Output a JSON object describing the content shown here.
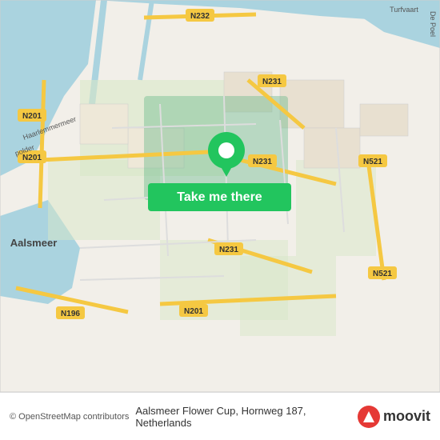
{
  "map": {
    "alt": "Map of Aalsmeer area, Netherlands",
    "pin_alt": "Location pin"
  },
  "button": {
    "label": "Take me there"
  },
  "bottom_bar": {
    "attribution": "© OpenStreetMap contributors",
    "location": "Aalsmeer Flower Cup, Hornweg 187, Netherlands"
  },
  "moovit": {
    "text": "moovit"
  },
  "road_labels": {
    "n232": "N232",
    "n231_top": "N231",
    "n231_mid1": "N231",
    "n231_mid2": "N231",
    "n201_left": "N201",
    "n201_left2": "N201",
    "n201_bot": "N201",
    "n196": "N196",
    "n231_bot": "N231",
    "n521": "N521",
    "n521_bot": "N521",
    "aalsmeer": "Aalsmeer"
  },
  "colors": {
    "button_bg": "#22c55e",
    "button_text": "#ffffff",
    "road_yellow": "#f5c842",
    "road_orange": "#e8943a",
    "water": "#aad3df",
    "land": "#f2efe9",
    "green_area": "#b8d8a8",
    "moovit_red": "#e53935"
  }
}
